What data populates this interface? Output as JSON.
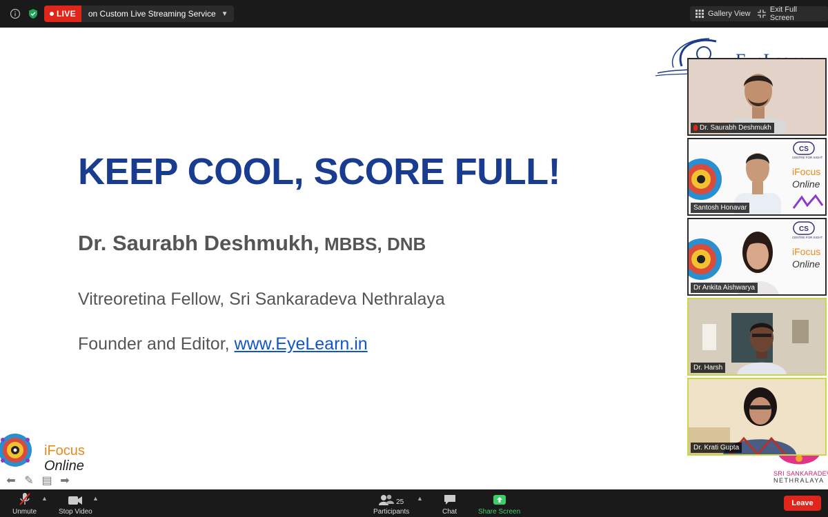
{
  "topbar": {
    "live_label": "LIVE",
    "stream_label": "on Custom Live Streaming Service",
    "gallery_view": "Gallery View",
    "exit_full_screen": "Exit Full Screen"
  },
  "slide": {
    "title": "KEEP COOL, SCORE FULL!",
    "presenter_name": "Dr. Saurabh Deshmukh,",
    "presenter_quals": " MBBS, DNB",
    "affiliation": "Vitreoretina Fellow, Sri Sankaradeva Nethralaya",
    "founder_prefix": "Founder and Editor, ",
    "founder_link": "www.EyeLearn.in",
    "ifocus_line1": "iFocus",
    "ifocus_line2": "Online",
    "eyelearn_logo_text": "EyeLearn",
    "ssn_line1": "SRI SANKARADEVA",
    "ssn_line2": "NETHRALAYA"
  },
  "participants_tiles": [
    {
      "name": "Dr. Saurabh Deshmukh",
      "muted": true
    },
    {
      "name": "Santosh Honavar",
      "muted": false
    },
    {
      "name": "Dr Ankita Aishwarya",
      "muted": false
    },
    {
      "name": "Dr. Harsh",
      "muted": false
    },
    {
      "name": "Dr. Krati Gupta",
      "muted": false
    }
  ],
  "tile_logo": {
    "cs_text": "CS",
    "cs_caption": "CENTRE FOR SIGHT",
    "line1": "iFocus",
    "line2": "Online"
  },
  "bottombar": {
    "unmute": "Unmute",
    "stop_video": "Stop Video",
    "participants": "Participants",
    "participants_count": "25",
    "chat": "Chat",
    "share_screen": "Share Screen",
    "leave": "Leave"
  },
  "colors": {
    "live_red": "#e0251b",
    "title_blue": "#1a3c8e",
    "link_blue": "#1155cc",
    "share_green": "#3ccf68",
    "active_border": "#c9d84a"
  }
}
